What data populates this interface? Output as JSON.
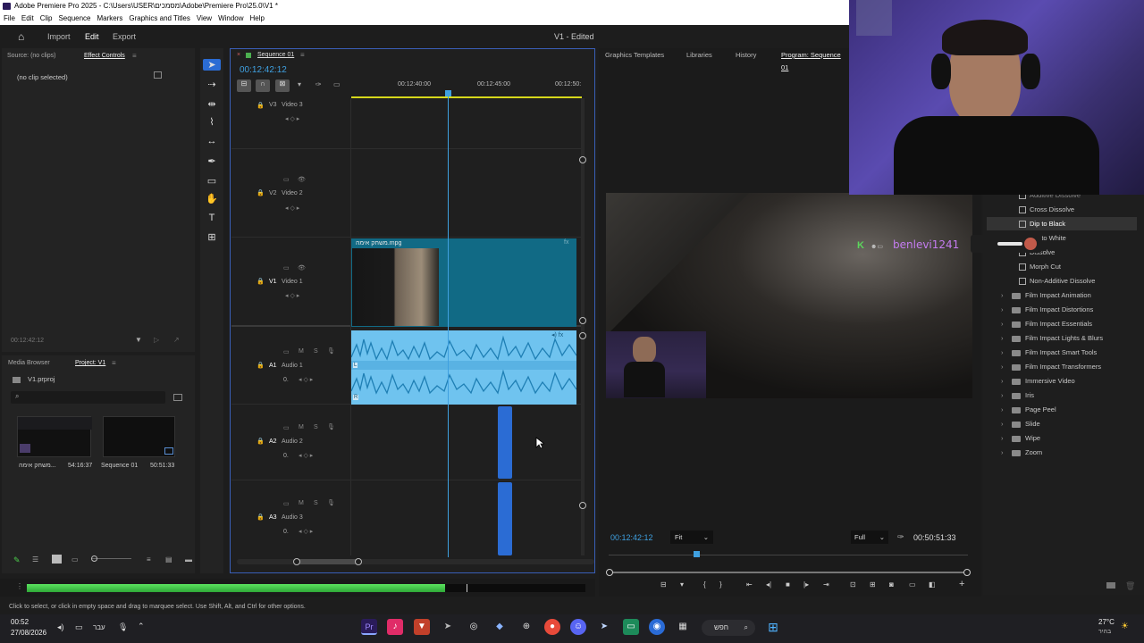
{
  "window": {
    "title": "Adobe Premiere Pro 2025 - C:\\Users\\USER\\מסמכים\\Adobe\\Premiere Pro\\25.0\\V1 *"
  },
  "menu": [
    "File",
    "Edit",
    "Clip",
    "Sequence",
    "Markers",
    "Graphics and Titles",
    "View",
    "Window",
    "Help"
  ],
  "workspace": {
    "import": "Import",
    "edit": "Edit",
    "export": "Export",
    "project_status": "V1 - Edited"
  },
  "source_panel": {
    "source_tab": "Source: (no clips)",
    "effect_controls_tab": "Effect Controls",
    "no_clip": "(no clip selected)",
    "timecode": "00:12:42:12"
  },
  "project_panel": {
    "media_browser_tab": "Media Browser",
    "project_tab": "Project: V1",
    "project_file": "V1.prproj",
    "search_placeholder": "",
    "items": [
      {
        "name": "משחק אימה...",
        "duration": "54:16:37"
      },
      {
        "name": "Sequence 01",
        "duration": "50:51:33"
      }
    ]
  },
  "timeline": {
    "sequence_tab": "Sequence 01",
    "timecode": "00:12:42:12",
    "ruler": [
      "00:12:40:00",
      "00:12:45:00",
      "00:12:50:"
    ],
    "tracks": {
      "v3": {
        "id": "V3",
        "name": "Video 3"
      },
      "v2": {
        "id": "V2",
        "name": "Video 2"
      },
      "v1": {
        "id": "V1",
        "name": "Video 1"
      },
      "a1": {
        "id": "A1",
        "name": "Audio 1",
        "vol": "0."
      },
      "a2": {
        "id": "A2",
        "name": "Audio 2",
        "vol": "0."
      },
      "a3": {
        "id": "A3",
        "name": "Audio 3",
        "vol": "0."
      }
    },
    "clip_name": "משחק אימה.mpg",
    "left_ch": "L",
    "right_ch": "R"
  },
  "program_panel": {
    "tabs": [
      "Graphics Templates",
      "Libraries",
      "History",
      "Program: Sequence 01"
    ],
    "timecode": "00:12:42:12",
    "fit": "Fit",
    "quality": "Full",
    "duration": "00:50:51:33",
    "overlay_user": "benlevi1241"
  },
  "effects": {
    "items": [
      "Additive Dissolve",
      "Cross Dissolve",
      "Dip to Black",
      "Dip to White",
      "Dissolve",
      "Morph Cut",
      "Non-Additive Dissolve"
    ],
    "folders": [
      "Film Impact Animation",
      "Film Impact Distortions",
      "Film Impact Essentials",
      "Film Impact Lights & Blurs",
      "Film Impact Smart Tools",
      "Film Impact Transformers",
      "Immersive Video",
      "Iris",
      "Page Peel",
      "Slide",
      "Wipe",
      "Zoom"
    ]
  },
  "status": {
    "hint": "Click to select, or click in empty space and drag to marquee select. Use Shift, Alt, and Ctrl for other options."
  },
  "taskbar": {
    "time": "00:52",
    "date": "27/08/2026",
    "lang": "עבר",
    "search": "חפש",
    "weather": "27°C",
    "weather_sub": "בהיר"
  },
  "colors": {
    "accent": "#2b6cd4",
    "clip_video": "#116a85",
    "clip_audio": "#6fc3ef",
    "playhead": "#3fa0e0",
    "meter": "#43d34a"
  }
}
